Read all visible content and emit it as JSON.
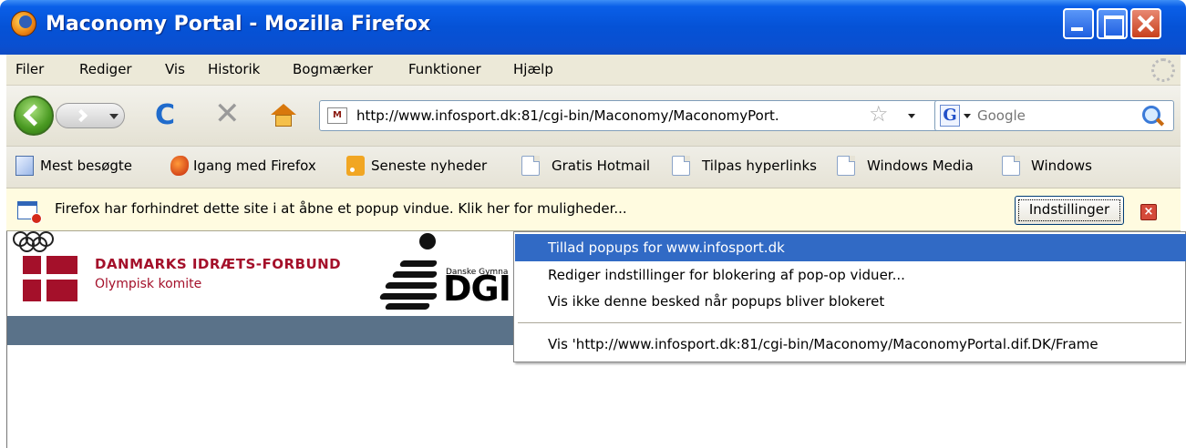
{
  "window": {
    "title": "Maconomy Portal - Mozilla Firefox"
  },
  "menubar": {
    "items": [
      "Filer",
      "Rediger",
      "Vis",
      "Historik",
      "Bogmærker",
      "Funktioner",
      "Hjælp"
    ]
  },
  "navbar": {
    "url": "http://www.infosport.dk:81/cgi-bin/Maconomy/MaconomyPort.",
    "site_icon_text": "M",
    "search_placeholder": "Google",
    "search_engine_letter": "G"
  },
  "bookmarks": [
    "Mest besøgte",
    "Igang med Firefox",
    "Seneste nyheder",
    "Gratis Hotmail",
    "Tilpas hyperlinks",
    "Windows Media",
    "Windows"
  ],
  "infobar": {
    "message": "Firefox har forhindret dette site i at åbne et popup vindue. Klik her for muligheder...",
    "button_label": "Indstillinger",
    "close_label": "×"
  },
  "page": {
    "dif_title": "DANMARKS IDRÆTS-FORBUND",
    "dif_subtitle": "Olympisk komite",
    "dgi_small": "Danske Gymna",
    "dgi_text": "DGI"
  },
  "popup": {
    "items": [
      "Tillad popups for www.infosport.dk",
      "Rediger indstillinger for blokering af pop-op viduer...",
      "Vis ikke denne besked når popups bliver blokeret",
      "Vis 'http://www.infosport.dk:81/cgi-bin/Maconomy/MaconomyPortal.dif.DK/Frame"
    ]
  },
  "colors": {
    "titlebar": "#0a55d8",
    "menu_highlight": "#316ac5",
    "dif_red": "#a4102a",
    "header_band": "#5a7289",
    "infobar": "#fffbe0"
  }
}
